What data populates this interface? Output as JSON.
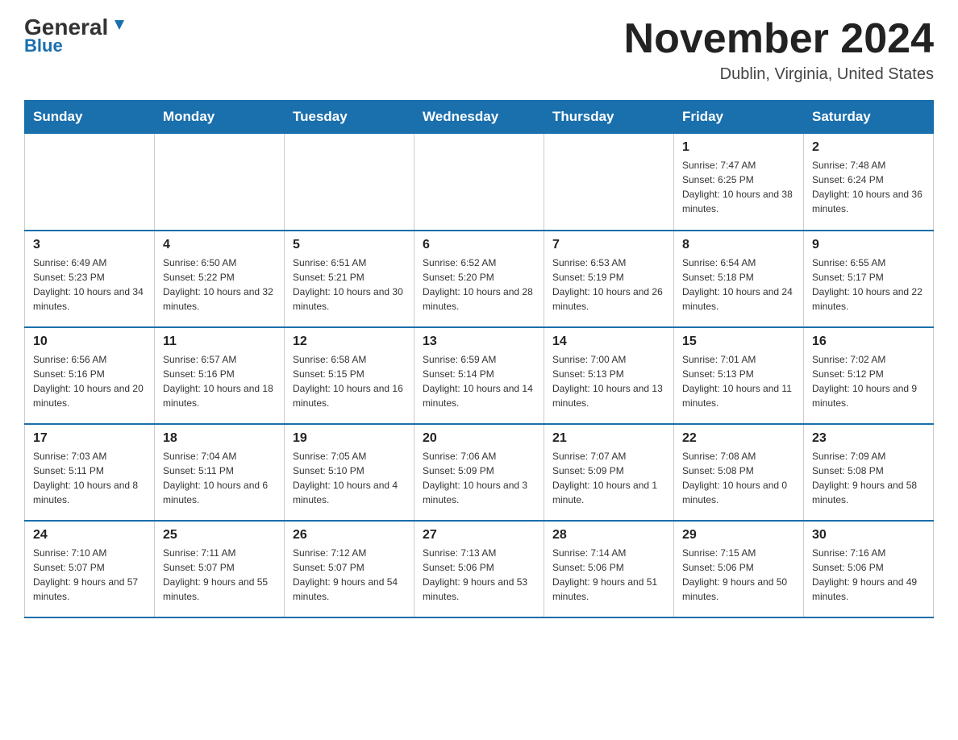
{
  "header": {
    "logo_line1": "General",
    "logo_line2": "Blue",
    "month_title": "November 2024",
    "location": "Dublin, Virginia, United States"
  },
  "days_of_week": [
    "Sunday",
    "Monday",
    "Tuesday",
    "Wednesday",
    "Thursday",
    "Friday",
    "Saturday"
  ],
  "weeks": [
    [
      {
        "day": "",
        "sunrise": "",
        "sunset": "",
        "daylight": ""
      },
      {
        "day": "",
        "sunrise": "",
        "sunset": "",
        "daylight": ""
      },
      {
        "day": "",
        "sunrise": "",
        "sunset": "",
        "daylight": ""
      },
      {
        "day": "",
        "sunrise": "",
        "sunset": "",
        "daylight": ""
      },
      {
        "day": "",
        "sunrise": "",
        "sunset": "",
        "daylight": ""
      },
      {
        "day": "1",
        "sunrise": "Sunrise: 7:47 AM",
        "sunset": "Sunset: 6:25 PM",
        "daylight": "Daylight: 10 hours and 38 minutes."
      },
      {
        "day": "2",
        "sunrise": "Sunrise: 7:48 AM",
        "sunset": "Sunset: 6:24 PM",
        "daylight": "Daylight: 10 hours and 36 minutes."
      }
    ],
    [
      {
        "day": "3",
        "sunrise": "Sunrise: 6:49 AM",
        "sunset": "Sunset: 5:23 PM",
        "daylight": "Daylight: 10 hours and 34 minutes."
      },
      {
        "day": "4",
        "sunrise": "Sunrise: 6:50 AM",
        "sunset": "Sunset: 5:22 PM",
        "daylight": "Daylight: 10 hours and 32 minutes."
      },
      {
        "day": "5",
        "sunrise": "Sunrise: 6:51 AM",
        "sunset": "Sunset: 5:21 PM",
        "daylight": "Daylight: 10 hours and 30 minutes."
      },
      {
        "day": "6",
        "sunrise": "Sunrise: 6:52 AM",
        "sunset": "Sunset: 5:20 PM",
        "daylight": "Daylight: 10 hours and 28 minutes."
      },
      {
        "day": "7",
        "sunrise": "Sunrise: 6:53 AM",
        "sunset": "Sunset: 5:19 PM",
        "daylight": "Daylight: 10 hours and 26 minutes."
      },
      {
        "day": "8",
        "sunrise": "Sunrise: 6:54 AM",
        "sunset": "Sunset: 5:18 PM",
        "daylight": "Daylight: 10 hours and 24 minutes."
      },
      {
        "day": "9",
        "sunrise": "Sunrise: 6:55 AM",
        "sunset": "Sunset: 5:17 PM",
        "daylight": "Daylight: 10 hours and 22 minutes."
      }
    ],
    [
      {
        "day": "10",
        "sunrise": "Sunrise: 6:56 AM",
        "sunset": "Sunset: 5:16 PM",
        "daylight": "Daylight: 10 hours and 20 minutes."
      },
      {
        "day": "11",
        "sunrise": "Sunrise: 6:57 AM",
        "sunset": "Sunset: 5:16 PM",
        "daylight": "Daylight: 10 hours and 18 minutes."
      },
      {
        "day": "12",
        "sunrise": "Sunrise: 6:58 AM",
        "sunset": "Sunset: 5:15 PM",
        "daylight": "Daylight: 10 hours and 16 minutes."
      },
      {
        "day": "13",
        "sunrise": "Sunrise: 6:59 AM",
        "sunset": "Sunset: 5:14 PM",
        "daylight": "Daylight: 10 hours and 14 minutes."
      },
      {
        "day": "14",
        "sunrise": "Sunrise: 7:00 AM",
        "sunset": "Sunset: 5:13 PM",
        "daylight": "Daylight: 10 hours and 13 minutes."
      },
      {
        "day": "15",
        "sunrise": "Sunrise: 7:01 AM",
        "sunset": "Sunset: 5:13 PM",
        "daylight": "Daylight: 10 hours and 11 minutes."
      },
      {
        "day": "16",
        "sunrise": "Sunrise: 7:02 AM",
        "sunset": "Sunset: 5:12 PM",
        "daylight": "Daylight: 10 hours and 9 minutes."
      }
    ],
    [
      {
        "day": "17",
        "sunrise": "Sunrise: 7:03 AM",
        "sunset": "Sunset: 5:11 PM",
        "daylight": "Daylight: 10 hours and 8 minutes."
      },
      {
        "day": "18",
        "sunrise": "Sunrise: 7:04 AM",
        "sunset": "Sunset: 5:11 PM",
        "daylight": "Daylight: 10 hours and 6 minutes."
      },
      {
        "day": "19",
        "sunrise": "Sunrise: 7:05 AM",
        "sunset": "Sunset: 5:10 PM",
        "daylight": "Daylight: 10 hours and 4 minutes."
      },
      {
        "day": "20",
        "sunrise": "Sunrise: 7:06 AM",
        "sunset": "Sunset: 5:09 PM",
        "daylight": "Daylight: 10 hours and 3 minutes."
      },
      {
        "day": "21",
        "sunrise": "Sunrise: 7:07 AM",
        "sunset": "Sunset: 5:09 PM",
        "daylight": "Daylight: 10 hours and 1 minute."
      },
      {
        "day": "22",
        "sunrise": "Sunrise: 7:08 AM",
        "sunset": "Sunset: 5:08 PM",
        "daylight": "Daylight: 10 hours and 0 minutes."
      },
      {
        "day": "23",
        "sunrise": "Sunrise: 7:09 AM",
        "sunset": "Sunset: 5:08 PM",
        "daylight": "Daylight: 9 hours and 58 minutes."
      }
    ],
    [
      {
        "day": "24",
        "sunrise": "Sunrise: 7:10 AM",
        "sunset": "Sunset: 5:07 PM",
        "daylight": "Daylight: 9 hours and 57 minutes."
      },
      {
        "day": "25",
        "sunrise": "Sunrise: 7:11 AM",
        "sunset": "Sunset: 5:07 PM",
        "daylight": "Daylight: 9 hours and 55 minutes."
      },
      {
        "day": "26",
        "sunrise": "Sunrise: 7:12 AM",
        "sunset": "Sunset: 5:07 PM",
        "daylight": "Daylight: 9 hours and 54 minutes."
      },
      {
        "day": "27",
        "sunrise": "Sunrise: 7:13 AM",
        "sunset": "Sunset: 5:06 PM",
        "daylight": "Daylight: 9 hours and 53 minutes."
      },
      {
        "day": "28",
        "sunrise": "Sunrise: 7:14 AM",
        "sunset": "Sunset: 5:06 PM",
        "daylight": "Daylight: 9 hours and 51 minutes."
      },
      {
        "day": "29",
        "sunrise": "Sunrise: 7:15 AM",
        "sunset": "Sunset: 5:06 PM",
        "daylight": "Daylight: 9 hours and 50 minutes."
      },
      {
        "day": "30",
        "sunrise": "Sunrise: 7:16 AM",
        "sunset": "Sunset: 5:06 PM",
        "daylight": "Daylight: 9 hours and 49 minutes."
      }
    ]
  ]
}
